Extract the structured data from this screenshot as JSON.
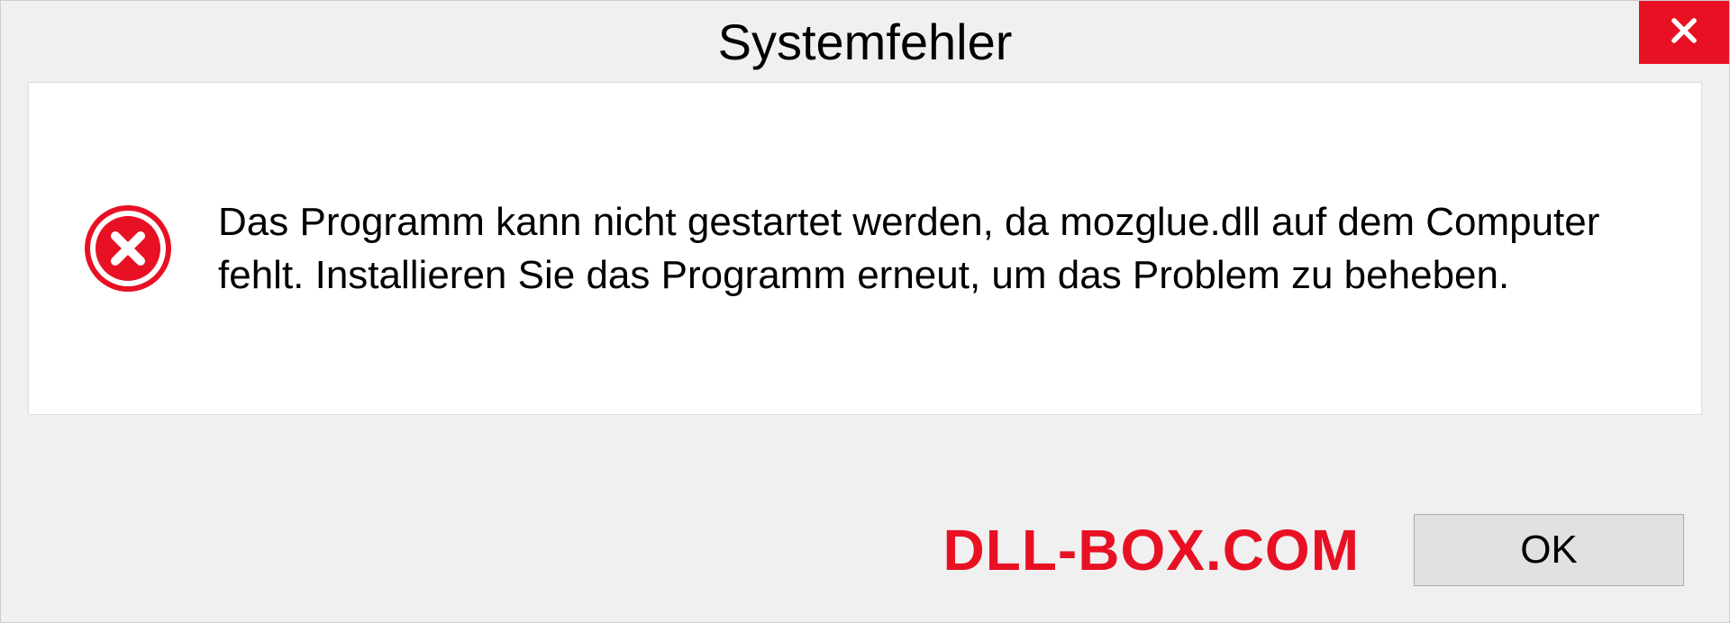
{
  "dialog": {
    "title": "Systemfehler",
    "message": "Das Programm kann nicht gestartet werden, da mozglue.dll auf dem Computer fehlt. Installieren Sie das Programm erneut, um das Problem zu beheben.",
    "ok_label": "OK",
    "watermark": "DLL-BOX.COM"
  }
}
